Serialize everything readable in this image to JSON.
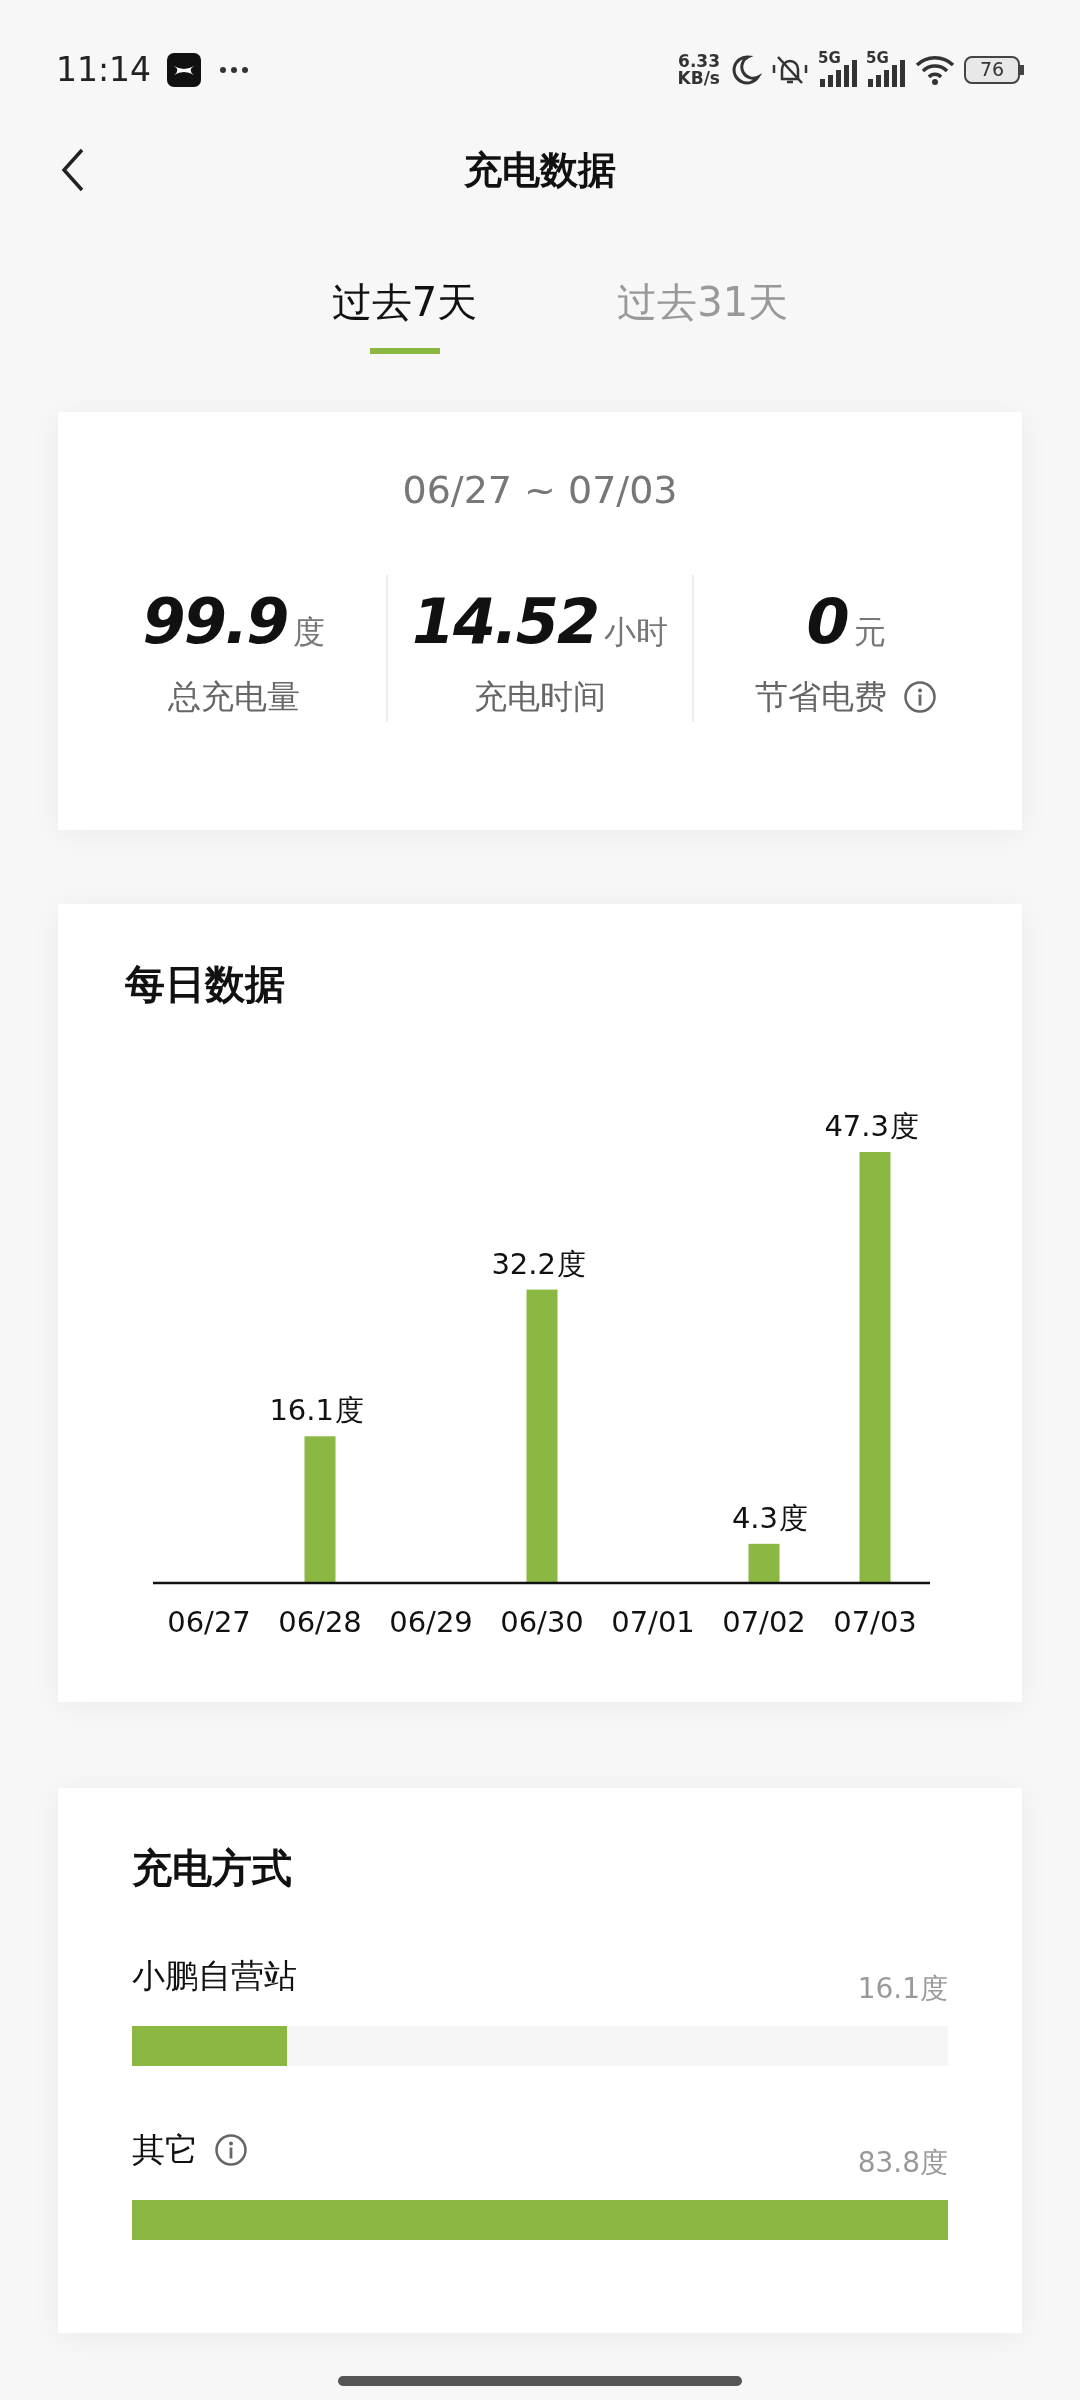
{
  "status_bar": {
    "time": "11:14",
    "net_speed_value": "6.33",
    "net_speed_unit": "KB/s",
    "sim_labels": [
      "5G",
      "5G"
    ],
    "battery": "76"
  },
  "header": {
    "title": "充电数据"
  },
  "tabs": [
    {
      "label": "过去7天",
      "selected": true
    },
    {
      "label": "过去31天",
      "selected": false
    }
  ],
  "summary": {
    "date_range": "06/27 ~ 07/03",
    "stats": [
      {
        "value": "99.9",
        "unit": "度",
        "label": "总充电量",
        "info": false
      },
      {
        "value": "14.52",
        "unit": "小时",
        "label": "充电时间",
        "info": false
      },
      {
        "value": "0",
        "unit": "元",
        "label": "节省电费",
        "info": true
      }
    ]
  },
  "daily": {
    "title": "每日数据",
    "chart_data": {
      "type": "bar",
      "categories": [
        "06/27",
        "06/28",
        "06/29",
        "06/30",
        "07/01",
        "07/02",
        "07/03"
      ],
      "series": [
        {
          "name": "度",
          "color": "#8ab843",
          "values": [
            null,
            16.1,
            null,
            32.2,
            null,
            4.3,
            47.3
          ]
        }
      ],
      "data_labels": true
    }
  },
  "methods": {
    "title": "充电方式",
    "items": [
      {
        "label": "小鹏自营站",
        "info": false,
        "value": "16.1度",
        "level": 0.19
      },
      {
        "label": "其它",
        "info": true,
        "value": "83.8度",
        "level": 1
      }
    ]
  }
}
